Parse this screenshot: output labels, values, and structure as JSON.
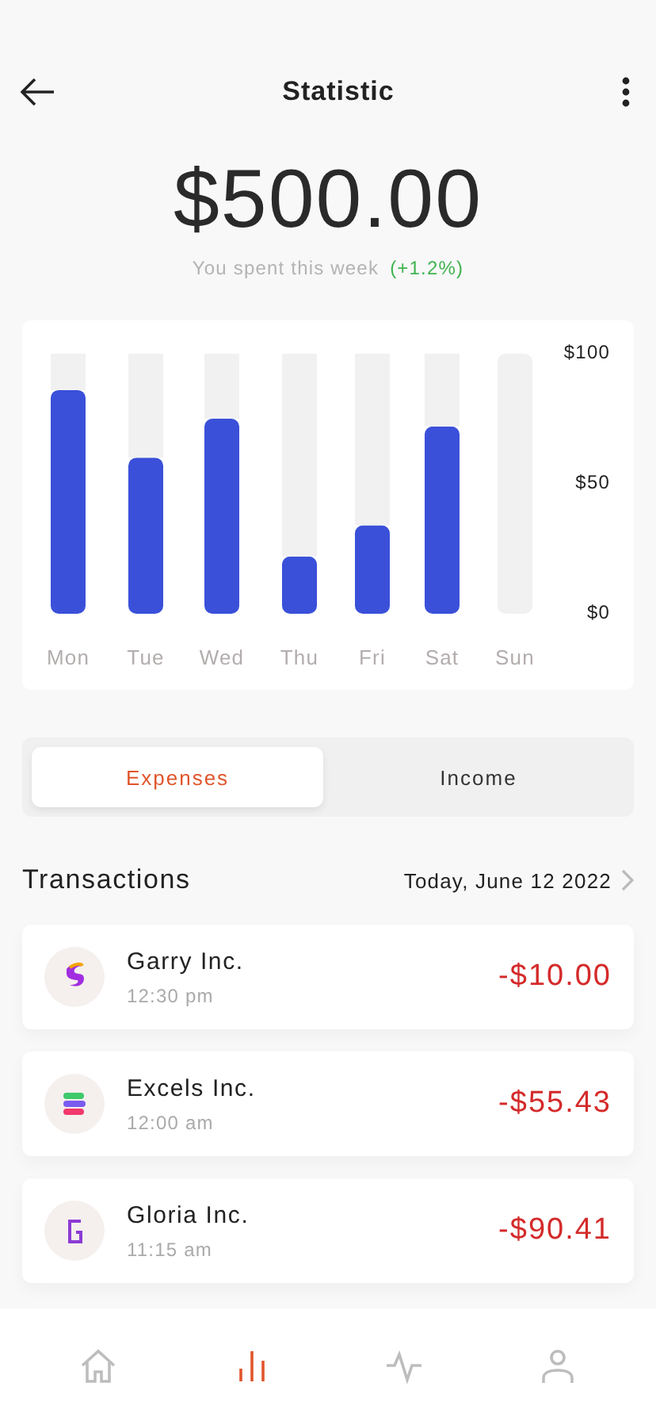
{
  "header": {
    "title": "Statistic"
  },
  "summary": {
    "amount": "$500.00",
    "caption": "You spent this week",
    "change": "(+1.2%)"
  },
  "chart_data": {
    "type": "bar",
    "categories": [
      "Mon",
      "Tue",
      "Wed",
      "Thu",
      "Fri",
      "Sat",
      "Sun"
    ],
    "stacked": true,
    "series": [
      {
        "color": "#3a50d9",
        "values": [
          86,
          60,
          75,
          22,
          34,
          72,
          0
        ]
      },
      {
        "color": "#f1f1f1",
        "values": [
          14,
          40,
          25,
          78,
          66,
          28,
          100
        ]
      }
    ],
    "ylim": [
      0,
      100
    ],
    "yticks": [
      {
        "value": 100,
        "label": "$100"
      },
      {
        "value": 50,
        "label": "$50"
      },
      {
        "value": 0,
        "label": "$0"
      }
    ]
  },
  "tabs": [
    {
      "label": "Expenses",
      "selected": true
    },
    {
      "label": "Income",
      "selected": false
    }
  ],
  "transactions": {
    "title": "Transactions",
    "date": "Today, June 12 2022",
    "items": [
      {
        "name": "Garry Inc.",
        "time": "12:30 pm",
        "amount": "-$10.00",
        "kind": "swirl"
      },
      {
        "name": "Excels Inc.",
        "time": "12:00 am",
        "amount": "-$55.43",
        "kind": "stripes"
      },
      {
        "name": "Gloria Inc.",
        "time": "11:15 am",
        "amount": "-$90.41",
        "kind": "bracket"
      }
    ]
  },
  "nav": [
    {
      "kind": "home",
      "selected": false
    },
    {
      "kind": "stats",
      "selected": true
    },
    {
      "kind": "activity",
      "selected": false
    },
    {
      "kind": "profile",
      "selected": false
    }
  ]
}
